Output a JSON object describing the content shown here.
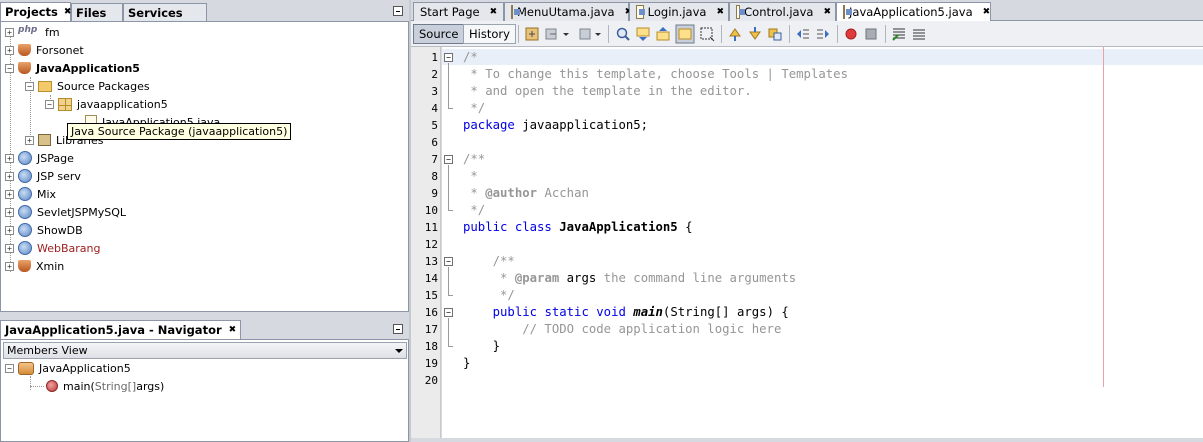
{
  "projects_panel": {
    "tabs": [
      {
        "label": "Projects",
        "active": true
      },
      {
        "label": "Files"
      },
      {
        "label": "Services"
      }
    ],
    "tree": [
      {
        "label": "fm",
        "icon": "php-icon"
      },
      {
        "label": "Forsonet",
        "icon": "java-project-icon"
      },
      {
        "label": "JavaApplication5",
        "icon": "java-project-icon"
      },
      {
        "label": "Source Packages",
        "icon": "folder-icon"
      },
      {
        "label": "javaapplication5",
        "icon": "package-icon"
      },
      {
        "label": "JavaApplication5.java",
        "icon": "java-file-icon"
      },
      {
        "label": "Libraries",
        "icon": "libraries-icon"
      },
      {
        "label": "JSPage",
        "icon": "web-project-icon"
      },
      {
        "label": "JSP serv",
        "icon": "web-project-icon"
      },
      {
        "label": "Mix",
        "icon": "web-project-icon"
      },
      {
        "label": "SevletJSPMySQL",
        "icon": "web-project-icon"
      },
      {
        "label": "ShowDB",
        "icon": "web-project-icon"
      },
      {
        "label": "WebBarang",
        "icon": "web-project-warning-icon"
      },
      {
        "label": "Xmin",
        "icon": "java-project-icon"
      }
    ],
    "tooltip": "Java Source Package (javaapplication5)"
  },
  "navigator": {
    "title": "JavaApplication5.java - Navigator",
    "view": "Members View",
    "class_name": "JavaApplication5",
    "method_name": "main(",
    "method_params": "String[]",
    "method_args": " args)"
  },
  "editor": {
    "tabs": [
      {
        "label": "Start Page"
      },
      {
        "label": "MenuUtama.java"
      },
      {
        "label": "Login.java"
      },
      {
        "label": "Control.java"
      },
      {
        "label": "JavaApplication5.java",
        "active": true
      }
    ],
    "source_label": "Source",
    "history_label": "History",
    "line_numbers": [
      "1",
      "2",
      "3",
      "4",
      "5",
      "6",
      "7",
      "8",
      "9",
      "10",
      "11",
      "12",
      "13",
      "14",
      "15",
      "16",
      "17",
      "18",
      "19",
      "20"
    ],
    "code": {
      "l1": "/*",
      "l2": " * To change this template, choose Tools | Templates",
      "l3": " * and open the template in the editor.",
      "l4": " */",
      "l5_kw": "package",
      "l5_rest": " javaapplication5;",
      "l7": "/**",
      "l8": " *",
      "l9_pre": " * ",
      "l9_tag": "@author",
      "l9_post": " Acchan",
      "l10": " */",
      "l11_kw": "public class",
      "l11_sp": " ",
      "l11_name": "JavaApplication5",
      "l11_post": " {",
      "l13": "    /**",
      "l14_pre": "     * ",
      "l14_tag": "@param",
      "l14_arg": " args",
      "l14_post": " the command line arguments",
      "l15": "     */",
      "l16_pre": "    ",
      "l16_kw": "public static void",
      "l16_sp": " ",
      "l16_name": "main",
      "l16_post": "(String[] args) {",
      "l17": "        // TODO code application logic here",
      "l18": "    }",
      "l19": "}"
    }
  }
}
